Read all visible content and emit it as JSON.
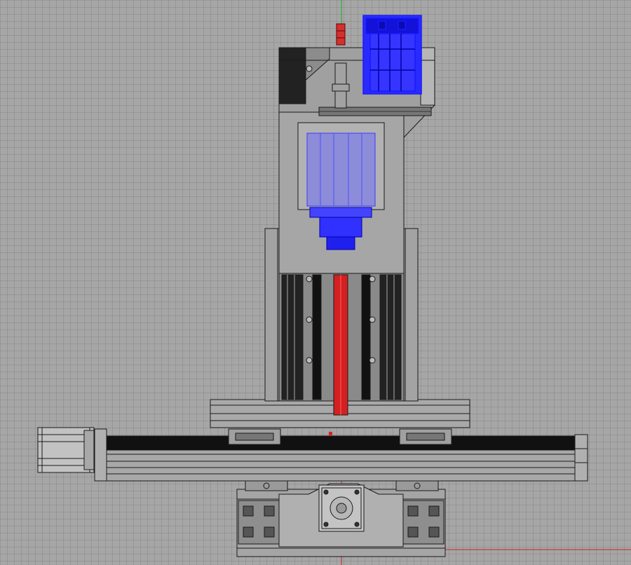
{
  "viewport": {
    "view": "front-orthographic",
    "display_mode": "wireframe-shaded",
    "grid": true
  },
  "colors": {
    "background": "#a6a6a6",
    "grid": "#989898",
    "outline": "#1a1a1a",
    "body_fill": "#9f9f9f",
    "light_fill": "#b3b3b3",
    "rail_dark": "#111111",
    "selection_blue": "#1a1aff",
    "spindle_fill": "#8c8cd8",
    "axis_red": "#e02020",
    "axis_green": "#19b019"
  },
  "components": [
    {
      "id": "spindle-motor",
      "highlighted": true
    },
    {
      "id": "spindle-mount",
      "highlighted": false
    },
    {
      "id": "router-spindle",
      "highlighted": true
    },
    {
      "id": "z-axis-column",
      "highlighted": false
    },
    {
      "id": "z-ballscrew",
      "highlighted": false
    },
    {
      "id": "gantry-crossbeam",
      "highlighted": false
    },
    {
      "id": "x-axis-rail",
      "highlighted": false
    },
    {
      "id": "x-stepper-motor",
      "highlighted": false
    },
    {
      "id": "base-extrusion",
      "highlighted": false
    },
    {
      "id": "y-stepper-motor",
      "highlighted": false
    }
  ]
}
